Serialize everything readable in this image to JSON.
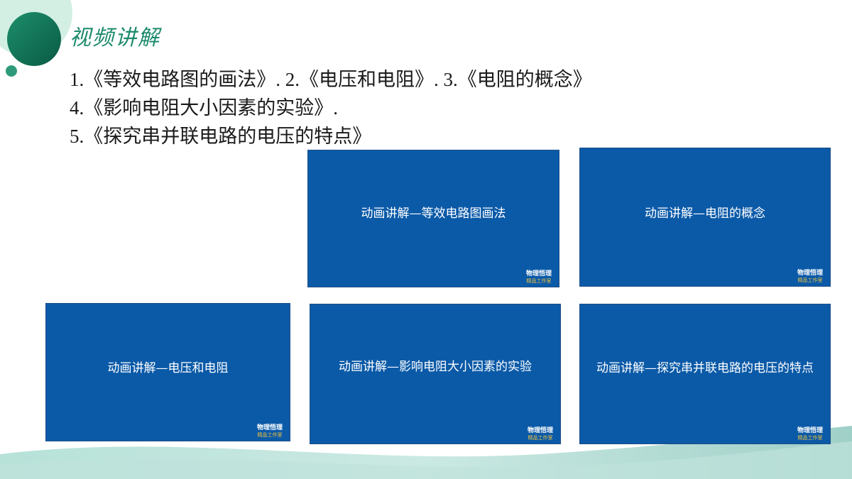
{
  "slide": {
    "title": "视频讲解",
    "lines": [
      {
        "parts": [
          {
            "num": "1.",
            "text": "《等效电路图的画法》"
          },
          {
            "num": ".  2.",
            "text": "《电压和电阻》"
          },
          {
            "num": ".  3.",
            "text": "《电阻的概念》"
          }
        ]
      },
      {
        "parts": [
          {
            "num": "4.",
            "text": "《影响电阻大小因素的实验》"
          },
          {
            "num": ".",
            "text": ""
          }
        ]
      },
      {
        "parts": [
          {
            "num": "5.",
            "text": "《探究串并联电路的电压的特点》"
          }
        ]
      }
    ]
  },
  "cards": [
    {
      "title": "动画讲解—等效电路图画法",
      "brand": "物理悟理",
      "brand_sub": "精品工作室"
    },
    {
      "title": "动画讲解—电阻的概念",
      "brand": "物理悟理",
      "brand_sub": "精品工作室"
    },
    {
      "title": "动画讲解—电压和电阻",
      "brand": "物理悟理",
      "brand_sub": "精品工作室"
    },
    {
      "title": "动画讲解—影响电阻大小因素的实验",
      "brand": "物理悟理",
      "brand_sub": "精品工作室"
    },
    {
      "title": "动画讲解—探究串并联电路的电压的特点",
      "brand": "物理悟理",
      "brand_sub": "精品工作室"
    }
  ],
  "colors": {
    "title_green": "#1d8a6c",
    "card_blue": "#0b5aa8",
    "brand_gold": "#f2c23a",
    "deco_dark_green": "#0f6f55",
    "deco_light_green": "#cfeee2",
    "wave_teal": "#a9d8d0"
  }
}
